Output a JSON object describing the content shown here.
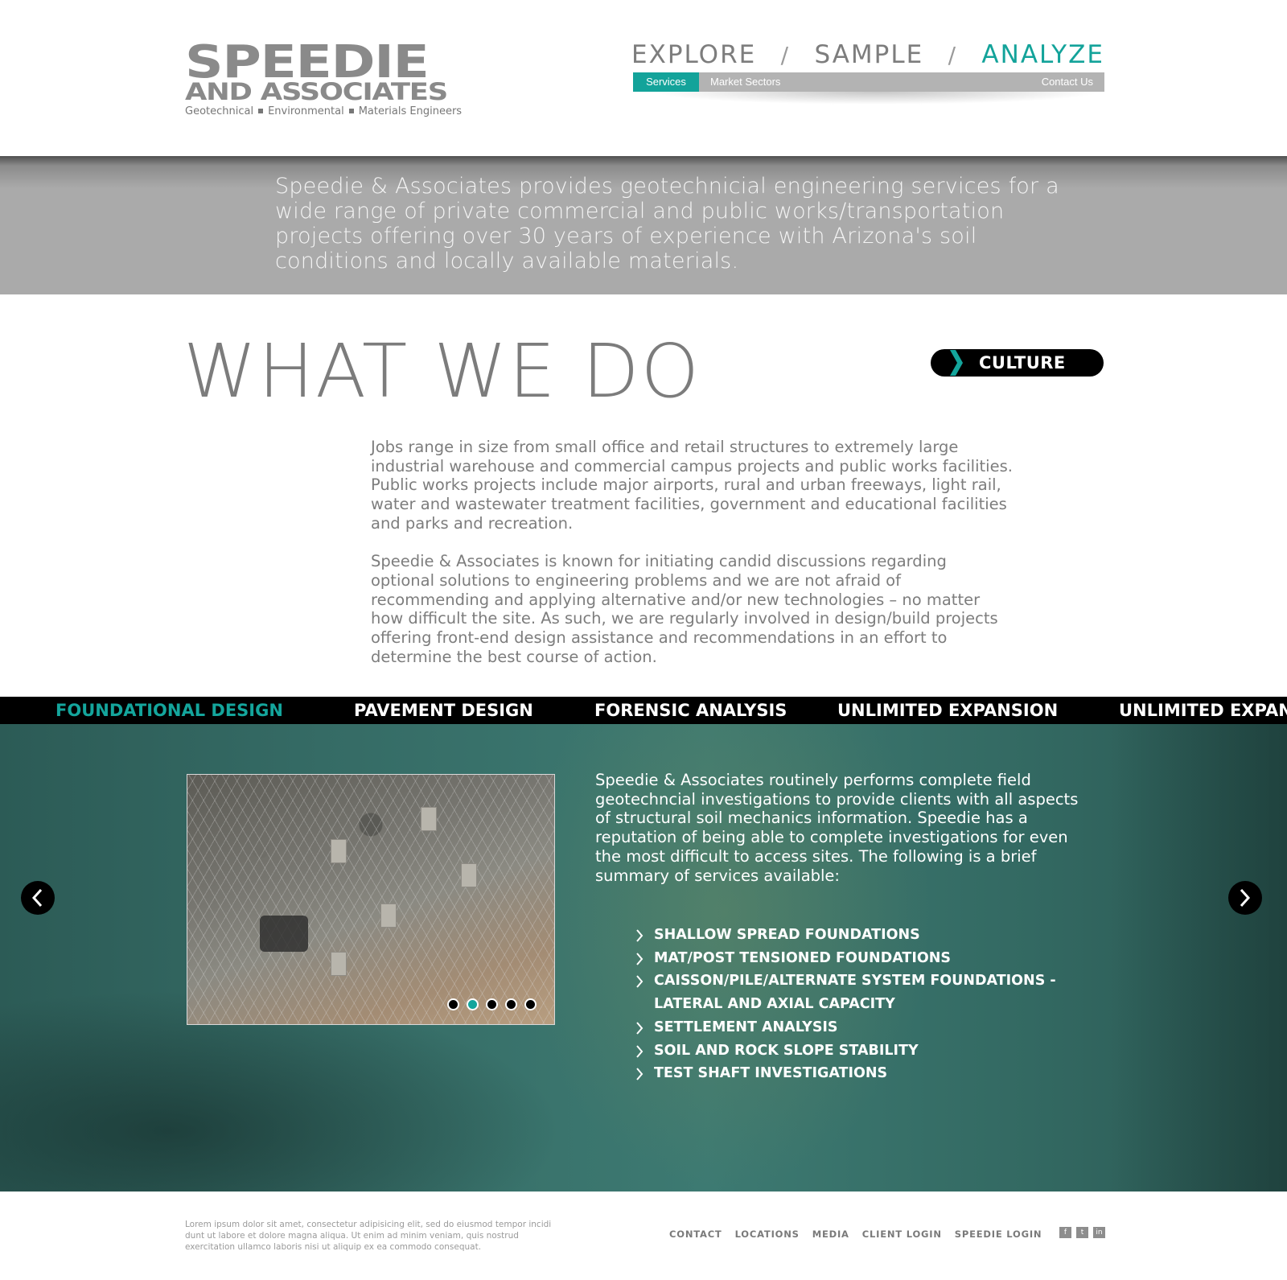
{
  "logo": {
    "line1": "SPEEDIE",
    "line2": "AND ASSOCIATES",
    "tagline": [
      "Geotechnical",
      "Environmental",
      "Materials Engineers"
    ]
  },
  "nav": {
    "items": [
      "EXPLORE",
      "SAMPLE",
      "ANALYZE"
    ],
    "separator": "/",
    "active": "ANALYZE"
  },
  "subnav": {
    "tabs": [
      "Services",
      "Market Sectors"
    ],
    "active": "Services",
    "contact": "Contact Us"
  },
  "intro": {
    "text": "Speedie & Associates provides geotechnicial engineering services for a wide range of private commercial and public works/transportation projects offering over 30 years of experience with Arizona's soil conditions and locally available materials."
  },
  "what_we_do": {
    "title": "WHAT WE DO",
    "culture_button": "CULTURE",
    "paragraphs": [
      "Jobs range in size from small office and retail structures to extremely large industrial warehouse and commercial campus projects and public works facilities. Public works projects include major airports, rural and urban freeways, light rail, water and wastewater treatment facilities, government and educational facilities and parks and recreation.",
      "Speedie & Associates is known for initiating candid discussions regarding optional solutions to engineering problems and we are not afraid of recommending and applying alternative and/or new technologies – no matter how difficult the site. As such, we are regularly involved in design/build projects offering front-end design assistance and recommendations in an effort to determine the best course of action."
    ]
  },
  "services_strip": {
    "tabs": [
      "FOUNDATIONAL DESIGN",
      "PAVEMENT DESIGN",
      "FORENSIC ANALYSIS",
      "UNLIMITED EXPANSION",
      "UNLIMITED EXPANSION"
    ],
    "active_index": 0
  },
  "panel": {
    "description": "Speedie & Associates routinely performs complete field geotechncial investigations to provide clients with all aspects of structural soil mechanics information. Speedie has a reputation of being able to complete investigations for even the most difficult to access sites. The following is a brief summary of services available:",
    "services": [
      "SHALLOW SPREAD FOUNDATIONS",
      "MAT/POST TENSIONED FOUNDATIONS",
      "CAISSON/PILE/ALTERNATE SYSTEM FOUNDATIONS -",
      "LATERAL AND AXIAL CAPACITY",
      "SETTLEMENT ANALYSIS",
      "SOIL AND ROCK SLOPE STABILITY",
      "TEST SHAFT INVESTIGATIONS"
    ],
    "slide_count": 5,
    "active_slide": 1,
    "prev_icon": "chevron-left-icon",
    "next_icon": "chevron-right-icon"
  },
  "footer": {
    "text": "Lorem ipsum dolor sit amet, consectetur adipisicing elit, sed do eiusmod tempor incidi dunt ut labore et dolore magna aliqua. Ut enim ad minim veniam, quis nostrud exercitation ullamco laboris nisi ut aliquip ex ea commodo consequat.",
    "links": [
      "CONTACT",
      "LOCATIONS",
      "MEDIA",
      "CLIENT LOGIN",
      "SPEEDIE LOGIN"
    ],
    "social": [
      "f",
      "t",
      "in"
    ]
  },
  "colors": {
    "accent": "#13a39a",
    "band": "#aaaaaa",
    "strip": "#000000"
  }
}
